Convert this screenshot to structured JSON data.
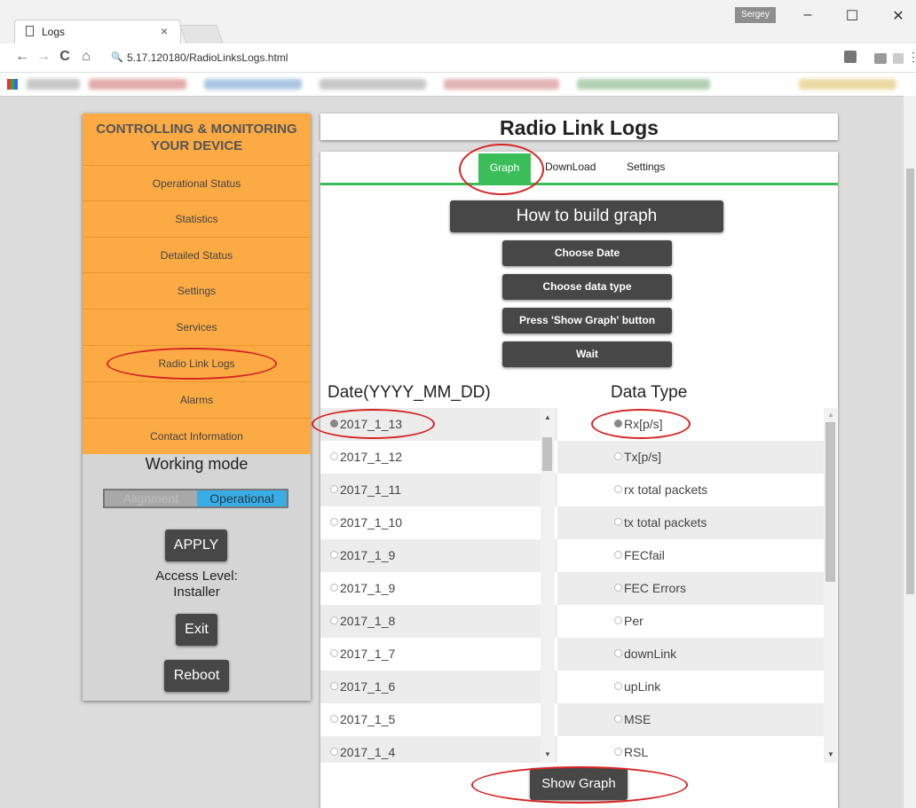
{
  "browser": {
    "tab_title": "Logs",
    "tab_close": "×",
    "profile_name": "Sergey",
    "url": "5.17.120180/RadioLinksLogs.html",
    "window_minimize": "–",
    "window_maximize": "☐",
    "window_close": "✕",
    "nav_back": "←",
    "nav_forward": "→",
    "nav_reload": "C",
    "nav_home": "⌂",
    "search_icon": "🔍"
  },
  "sidebar": {
    "header_line1": "CONTROLLING & MONITORING",
    "header_line2": "YOUR DEVICE",
    "items": [
      {
        "label": "Operational Status"
      },
      {
        "label": "Statistics"
      },
      {
        "label": "Detailed Status"
      },
      {
        "label": "Settings"
      },
      {
        "label": "Services"
      },
      {
        "label": "Radio Link Logs"
      },
      {
        "label": "Alarms"
      },
      {
        "label": "Contact Information"
      }
    ],
    "working_mode_label": "Working mode",
    "mode_alignment": "Alignment",
    "mode_operational": "Operational",
    "selected_mode": "Operational",
    "apply_label": "APPLY",
    "access_level_label": "Access Level:",
    "access_level_value": "Installer",
    "exit_label": "Exit",
    "reboot_label": "Reboot"
  },
  "main": {
    "title": "Radio Link Logs",
    "tabs": [
      {
        "label": "Graph",
        "active": true
      },
      {
        "label": "DownLoad",
        "active": false
      },
      {
        "label": "Settings",
        "active": false
      }
    ],
    "how_to_title": "How to build graph",
    "steps": [
      "Choose Date",
      "Choose data type",
      "Press 'Show Graph' button",
      "Wait"
    ],
    "date_header": "Date(YYYY_MM_DD)",
    "type_header": "Data Type",
    "dates": [
      "2017_1_13",
      "2017_1_12",
      "2017_1_11",
      "2017_1_10",
      "2017_1_9",
      "2017_1_9",
      "2017_1_8",
      "2017_1_7",
      "2017_1_6",
      "2017_1_5",
      "2017_1_4"
    ],
    "selected_date": "2017_1_13",
    "data_types": [
      "Rx[p/s]",
      "Tx[p/s]",
      "rx total packets",
      "tx total packets",
      "FECfail",
      "FEC Errors",
      "Per",
      "downLink",
      "upLink",
      "MSE",
      "RSL"
    ],
    "selected_type": "Rx[p/s]",
    "show_graph_label": "Show Graph"
  },
  "colors": {
    "sidebar_orange": "#fbaa44",
    "accent_green": "#3bbd5a",
    "button_dark": "#474747",
    "mode_blue": "#39aee6",
    "annotation_red": "#d62424"
  }
}
